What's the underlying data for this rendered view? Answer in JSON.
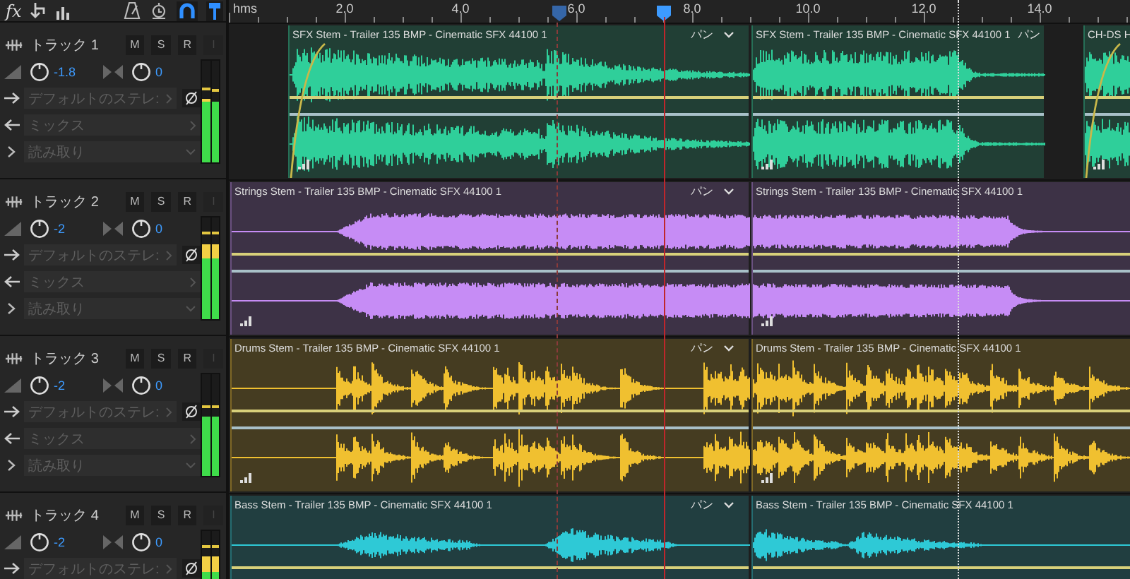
{
  "toolbar": {
    "tools": [
      {
        "kind": "fx",
        "label": "fx"
      },
      {
        "kind": "routing"
      },
      {
        "kind": "meter"
      },
      {
        "kind": "metronome",
        "selected": false
      },
      {
        "kind": "timer",
        "selected": false
      },
      {
        "kind": "snap",
        "selected": true
      },
      {
        "kind": "pin",
        "selected": true
      }
    ]
  },
  "ruler": {
    "unit": "hms",
    "labels": [
      "2.0",
      "4.0",
      "6.0",
      "8.0",
      "10.0",
      "12.0",
      "14.0"
    ]
  },
  "tracks": [
    {
      "name": "トラック 1",
      "color": "#2fcf9a",
      "buttons": [
        {
          "label": "M",
          "disabled": false
        },
        {
          "label": "S",
          "disabled": false
        },
        {
          "label": "R",
          "disabled": false
        },
        {
          "label": "I",
          "disabled": true
        }
      ],
      "volume": "-1.8",
      "pan": "0",
      "output": "デフォルトのステレ:",
      "send": "ミックス",
      "automation": "読み取り",
      "meter": [
        {
          "level": 0.62
        },
        {
          "level": 0.6
        }
      ],
      "clips": [
        {
          "title": "SFX Stem - Trailer 135 BMP - Cinematic SFX 44100 1",
          "pan_label": "パン",
          "fade_in": true
        },
        {
          "title": "SFX Stem - Trailer 135 BMP - Cinematic SFX 44100 1",
          "pan_label": "パン",
          "fade_in": false
        },
        {
          "title": "CH-DS H",
          "fade_in": true
        }
      ]
    },
    {
      "name": "トラック 2",
      "color": "#c68cf5",
      "buttons": [
        {
          "label": "M",
          "disabled": false
        },
        {
          "label": "S",
          "disabled": false
        },
        {
          "label": "R",
          "disabled": false
        },
        {
          "label": "I",
          "disabled": true
        }
      ],
      "volume": "-2",
      "pan": "0",
      "output": "デフォルトのステレ:",
      "send": "ミックス",
      "automation": "読み取り",
      "meter": [
        {
          "level": 0.74
        },
        {
          "level": 0.74
        }
      ],
      "clips": [
        {
          "title": "Strings Stem - Trailer 135 BMP - Cinematic SFX 44100 1",
          "pan_label": "パン",
          "fade_in": false
        },
        {
          "title": "Strings Stem - Trailer 135 BMP - Cinematic SFX 44100 1",
          "fade_in": false
        }
      ]
    },
    {
      "name": "トラック 3",
      "color": "#f0c030",
      "buttons": [
        {
          "label": "M",
          "disabled": false
        },
        {
          "label": "S",
          "disabled": false
        },
        {
          "label": "R",
          "disabled": false
        },
        {
          "label": "I",
          "disabled": true
        }
      ],
      "volume": "-2",
      "pan": "0",
      "output": "デフォルトのステレ:",
      "send": "ミックス",
      "automation": "読み取り",
      "meter": [
        {
          "level": 0.58
        },
        {
          "level": 0.58
        }
      ],
      "clips": [
        {
          "title": "Drums Stem - Trailer 135 BMP - Cinematic SFX 44100 1",
          "pan_label": "パン",
          "fade_in": false
        },
        {
          "title": "Drums Stem - Trailer 135 BMP - Cinematic SFX 44100 1",
          "fade_in": false
        }
      ]
    },
    {
      "name": "トラック 4",
      "color": "#2ec9d6",
      "buttons": [
        {
          "label": "M",
          "disabled": false
        },
        {
          "label": "S",
          "disabled": false
        },
        {
          "label": "R",
          "disabled": false
        },
        {
          "label": "I",
          "disabled": true
        }
      ],
      "volume": "-2",
      "pan": "0",
      "output": "デフォルトのステレ:",
      "meter": [
        {
          "level": 0.75
        },
        {
          "level": 0.75
        }
      ],
      "clips": [
        {
          "title": "Bass Stem - Trailer 135 BMP - Cinematic SFX 44100 1",
          "pan_label": "パン",
          "fade_in": false
        },
        {
          "title": "Bass Stem - Trailer 135 BMP - Cinematic SFX 44100 1",
          "fade_in": false
        }
      ]
    }
  ]
}
